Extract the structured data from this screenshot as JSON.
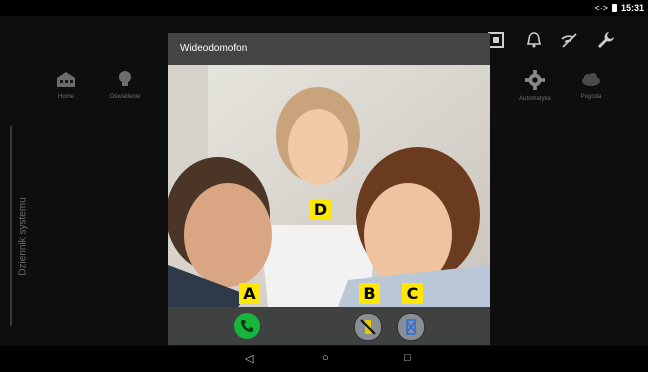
{
  "status": {
    "time": "15:31",
    "signal": "<·>"
  },
  "sidebar": {
    "label": "Dziennik systemu"
  },
  "tiles": [
    {
      "label": "Home",
      "icon": "home-icon"
    },
    {
      "label": "Oświetlenie",
      "icon": "bulb-icon"
    },
    {
      "label": "Automatyka",
      "icon": "gear-icon"
    },
    {
      "label": "Pogoda",
      "icon": "cloud-icon"
    }
  ],
  "dialog": {
    "title": "Wideodomofon"
  },
  "markers": {
    "a": "A",
    "b": "B",
    "c": "C",
    "d": "D"
  },
  "controls": {
    "answer": {
      "icon": "phone-icon",
      "color": "#17b53c"
    },
    "open": {
      "icon": "door-icon"
    },
    "close": {
      "icon": "cancel-icon"
    }
  },
  "nav": {
    "back": "◁",
    "home": "○",
    "recent": "□"
  }
}
